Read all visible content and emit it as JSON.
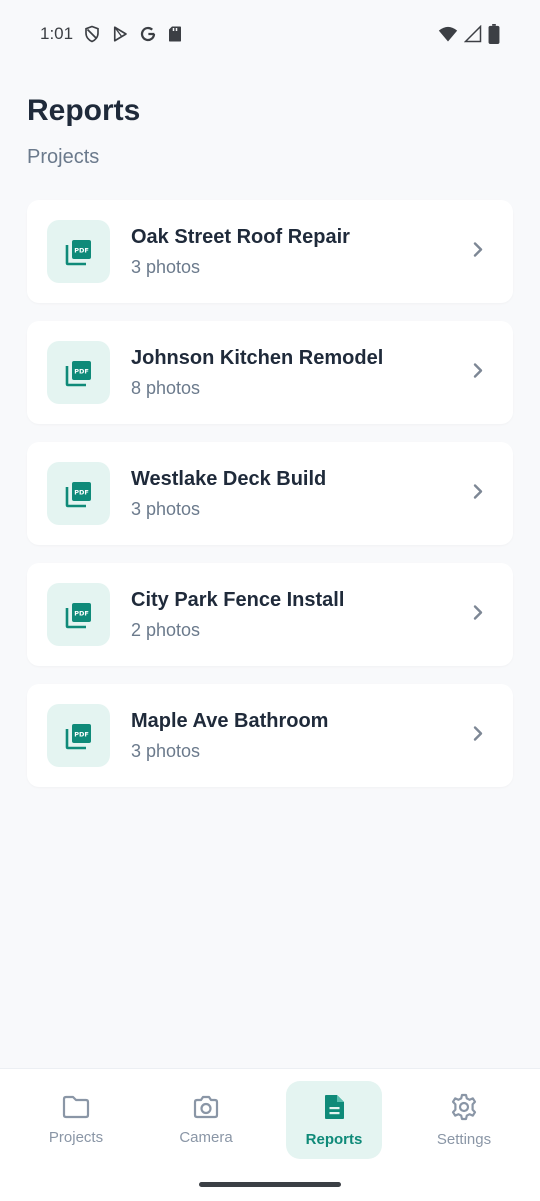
{
  "status_bar": {
    "time": "1:01",
    "left_icons": [
      "shield-icon",
      "play-store-icon",
      "google-icon",
      "sd-card-icon"
    ],
    "right_icons": [
      "wifi-icon",
      "signal-icon",
      "battery-icon"
    ]
  },
  "header": {
    "title": "Reports",
    "subtitle": "Projects"
  },
  "projects": [
    {
      "name": "Oak Street Roof Repair",
      "photos": "3 photos",
      "icon": "pdf-icon"
    },
    {
      "name": "Johnson Kitchen Remodel",
      "photos": "8 photos",
      "icon": "pdf-icon"
    },
    {
      "name": "Westlake Deck Build",
      "photos": "3 photos",
      "icon": "pdf-icon"
    },
    {
      "name": "City Park Fence Install",
      "photos": "2 photos",
      "icon": "pdf-icon"
    },
    {
      "name": "Maple Ave Bathroom",
      "photos": "3 photos",
      "icon": "pdf-icon"
    }
  ],
  "bottom_nav": [
    {
      "label": "Projects",
      "icon": "folder-icon",
      "active": false
    },
    {
      "label": "Camera",
      "icon": "camera-icon",
      "active": false
    },
    {
      "label": "Reports",
      "icon": "document-icon",
      "active": true
    },
    {
      "label": "Settings",
      "icon": "gear-icon",
      "active": false
    }
  ],
  "colors": {
    "accent": "#0f8a79",
    "accent_bg": "#e4f4f1",
    "background": "#f8f9fb",
    "text_primary": "#1f2a3a",
    "text_secondary": "#6b7a8c"
  }
}
